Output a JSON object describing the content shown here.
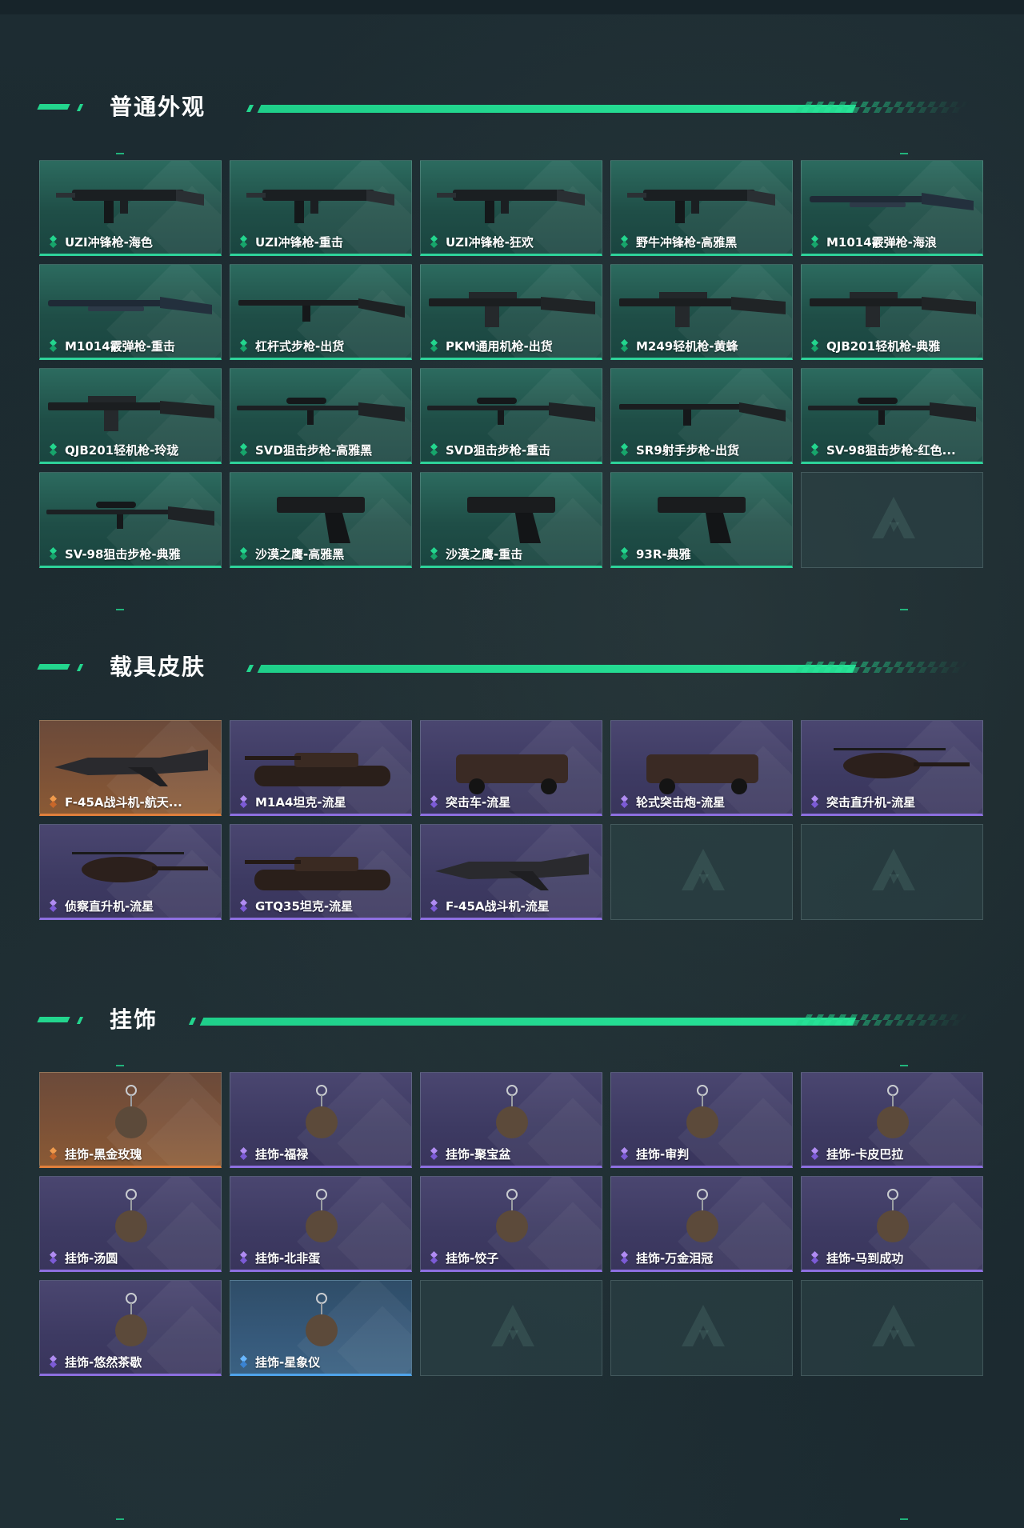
{
  "colors": {
    "accent": "#23d68e",
    "tier_green": "#2ed39a",
    "tier_purple": "#8d6fe0",
    "tier_orange": "#e07f3c",
    "tier_blue": "#4fa3ea",
    "background": "#1b2a30"
  },
  "sections": {
    "weapons": {
      "title": "普通外观",
      "items": [
        {
          "label": "UZI冲锋枪-海色",
          "tier": "green",
          "icon": "smg-icon"
        },
        {
          "label": "UZI冲锋枪-重击",
          "tier": "green",
          "icon": "smg-icon"
        },
        {
          "label": "UZI冲锋枪-狂欢",
          "tier": "green",
          "icon": "smg-icon"
        },
        {
          "label": "野牛冲锋枪-高雅黑",
          "tier": "green",
          "icon": "smg-icon"
        },
        {
          "label": "M1014霰弹枪-海浪",
          "tier": "green",
          "icon": "shotgun-icon"
        },
        {
          "label": "M1014霰弹枪-重击",
          "tier": "green",
          "icon": "shotgun-icon"
        },
        {
          "label": "杠杆式步枪-出货",
          "tier": "green",
          "icon": "rifle-icon"
        },
        {
          "label": "PKM通用机枪-出货",
          "tier": "green",
          "icon": "machine-gun-icon"
        },
        {
          "label": "M249轻机枪-黄蜂",
          "tier": "green",
          "icon": "machine-gun-icon"
        },
        {
          "label": "QJB201轻机枪-典雅",
          "tier": "green",
          "icon": "machine-gun-icon"
        },
        {
          "label": "QJB201轻机枪-玲珑",
          "tier": "green",
          "icon": "machine-gun-icon"
        },
        {
          "label": "SVD狙击步枪-高雅黑",
          "tier": "green",
          "icon": "sniper-rifle-icon"
        },
        {
          "label": "SVD狙击步枪-重击",
          "tier": "green",
          "icon": "sniper-rifle-icon"
        },
        {
          "label": "SR9射手步枪-出货",
          "tier": "green",
          "icon": "rifle-icon"
        },
        {
          "label": "SV-98狙击步枪-红色...",
          "tier": "green",
          "icon": "sniper-rifle-icon"
        },
        {
          "label": "SV-98狙击步枪-典雅",
          "tier": "green",
          "icon": "sniper-rifle-icon"
        },
        {
          "label": "沙漠之鹰-高雅黑",
          "tier": "green",
          "icon": "pistol-icon"
        },
        {
          "label": "沙漠之鹰-重击",
          "tier": "green",
          "icon": "pistol-icon"
        },
        {
          "label": "93R-典雅",
          "tier": "green",
          "icon": "pistol-icon"
        },
        {
          "empty": true
        }
      ]
    },
    "vehicles": {
      "title": "载具皮肤",
      "items": [
        {
          "label": "F-45A战斗机-航天...",
          "tier": "orange",
          "icon": "fighter-jet-icon"
        },
        {
          "label": "M1A4坦克-流星",
          "tier": "purple",
          "icon": "tank-icon"
        },
        {
          "label": "突击车-流星",
          "tier": "purple",
          "icon": "assault-vehicle-icon"
        },
        {
          "label": "轮式突击炮-流星",
          "tier": "purple",
          "icon": "assault-vehicle-icon"
        },
        {
          "label": "突击直升机-流星",
          "tier": "purple",
          "icon": "helicopter-icon"
        },
        {
          "label": "侦察直升机-流星",
          "tier": "purple",
          "icon": "helicopter-icon"
        },
        {
          "label": "GTQ35坦克-流星",
          "tier": "purple",
          "icon": "tank-icon"
        },
        {
          "label": "F-45A战斗机-流星",
          "tier": "purple",
          "icon": "fighter-jet-icon"
        },
        {
          "empty": true
        },
        {
          "empty": true
        }
      ]
    },
    "charms": {
      "title": "挂饰",
      "items": [
        {
          "label": "挂饰-黑金玫瑰",
          "tier": "orange",
          "icon": "charm-icon"
        },
        {
          "label": "挂饰-福禄",
          "tier": "purple",
          "icon": "charm-icon"
        },
        {
          "label": "挂饰-聚宝盆",
          "tier": "purple",
          "icon": "charm-icon"
        },
        {
          "label": "挂饰-审判",
          "tier": "purple",
          "icon": "charm-icon"
        },
        {
          "label": "挂饰-卡皮巴拉",
          "tier": "purple",
          "icon": "charm-icon"
        },
        {
          "label": "挂饰-汤圆",
          "tier": "purple",
          "icon": "charm-icon"
        },
        {
          "label": "挂饰-北非蛋",
          "tier": "purple",
          "icon": "charm-icon"
        },
        {
          "label": "挂饰-饺子",
          "tier": "purple",
          "icon": "charm-icon"
        },
        {
          "label": "挂饰-万金泪冠",
          "tier": "purple",
          "icon": "charm-icon"
        },
        {
          "label": "挂饰-马到成功",
          "tier": "purple",
          "icon": "charm-icon"
        },
        {
          "label": "挂饰-悠然茶歇",
          "tier": "purple",
          "icon": "charm-icon"
        },
        {
          "label": "挂饰-星象仪",
          "tier": "blue",
          "icon": "charm-icon"
        },
        {
          "empty": true
        },
        {
          "empty": true
        },
        {
          "empty": true
        }
      ]
    }
  }
}
